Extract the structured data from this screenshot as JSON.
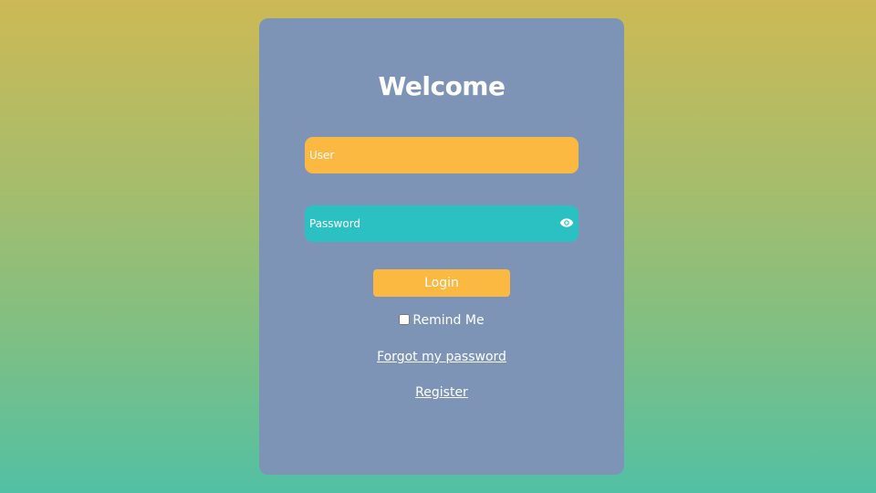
{
  "page": {
    "title": "Welcome"
  },
  "form": {
    "user_placeholder": "User",
    "password_placeholder": "Password",
    "password_toggle_icon": "eye-icon",
    "login_label": "Login",
    "remind_label": "Remind Me",
    "remind_checked": false,
    "forgot_label": "Forgot my password",
    "register_label": "Register"
  },
  "colors": {
    "card_background": "#7e94b6",
    "user_field": "#fcb941",
    "password_field": "#2bc1c3",
    "login_button": "#fcb941",
    "text": "#ffffff"
  }
}
